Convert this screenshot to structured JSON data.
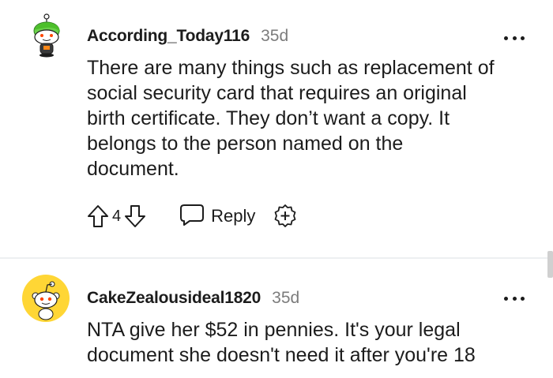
{
  "comments": [
    {
      "username": "According_Today116",
      "age": "35d",
      "lines": [
        "There are many things such as replacement of",
        "social security card that requires an original",
        "birth certificate. They don’t want a copy. It",
        "belongs to the person named on the",
        "document."
      ],
      "vote_count": "4",
      "reply_label": "Reply",
      "avatar_icon": "snoo-green-hair-avatar-icon",
      "actions_icons": [
        "upvote-arrow-icon",
        "downvote-arrow-icon",
        "chat-bubble-icon",
        "award-plus-icon"
      ]
    },
    {
      "username": "CakeZealousideal1820",
      "age": "35d",
      "lines": [
        "NTA give her $52 in pennies. It's your legal",
        "document she doesn't need it after you're 18"
      ],
      "avatar_icon": "snoo-default-yellow-avatar-icon"
    }
  ],
  "colors": {
    "text": "#1c1c1c",
    "meta": "#7c7c7c",
    "divider": "#edeff1",
    "avatar_yellow": "#ffd635"
  }
}
